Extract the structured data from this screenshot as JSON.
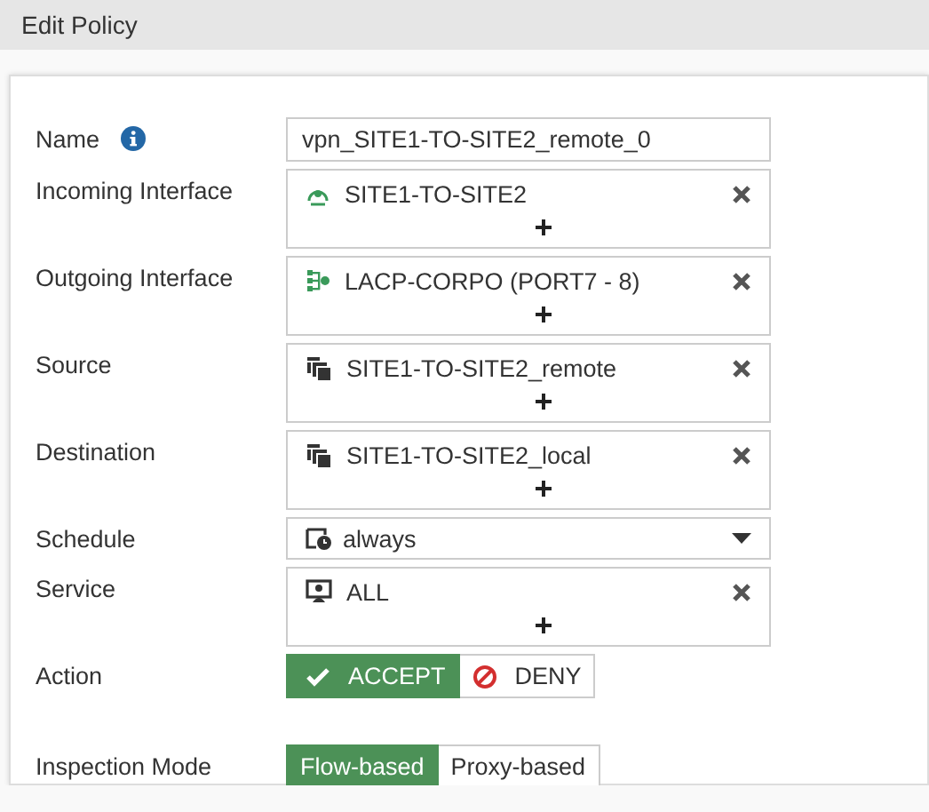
{
  "title": "Edit Policy",
  "fields": [
    {
      "kind": "text",
      "label": "Name",
      "info": true,
      "value": "vpn_SITE1-TO-SITE2_remote_0"
    },
    {
      "kind": "multi",
      "label": "Incoming Interface",
      "entries": [
        {
          "kind": "tunnel",
          "text": "SITE1-TO-SITE2"
        }
      ]
    },
    {
      "kind": "multi",
      "label": "Outgoing Interface",
      "entries": [
        {
          "kind": "aggregate",
          "text": "LACP-CORPO (PORT7 - 8)"
        }
      ]
    },
    {
      "kind": "multi",
      "label": "Source",
      "entries": [
        {
          "kind": "group",
          "text": "SITE1-TO-SITE2_remote"
        }
      ]
    },
    {
      "kind": "multi",
      "label": "Destination",
      "entries": [
        {
          "kind": "group",
          "text": "SITE1-TO-SITE2_local"
        }
      ]
    },
    {
      "kind": "select",
      "label": "Schedule",
      "value": "always"
    },
    {
      "kind": "multi",
      "label": "Service",
      "entries": [
        {
          "kind": "service",
          "text": "ALL"
        }
      ]
    },
    {
      "kind": "toggle",
      "label": "Action",
      "options": [
        {
          "kind": "accept",
          "text": "ACCEPT",
          "selected": true
        },
        {
          "kind": "deny",
          "text": "DENY",
          "selected": false
        }
      ]
    },
    {
      "kind": "toggle",
      "label": "Inspection Mode",
      "options": [
        {
          "text": "Flow-based",
          "selected": true
        },
        {
          "text": "Proxy-based",
          "selected": false
        }
      ]
    }
  ]
}
